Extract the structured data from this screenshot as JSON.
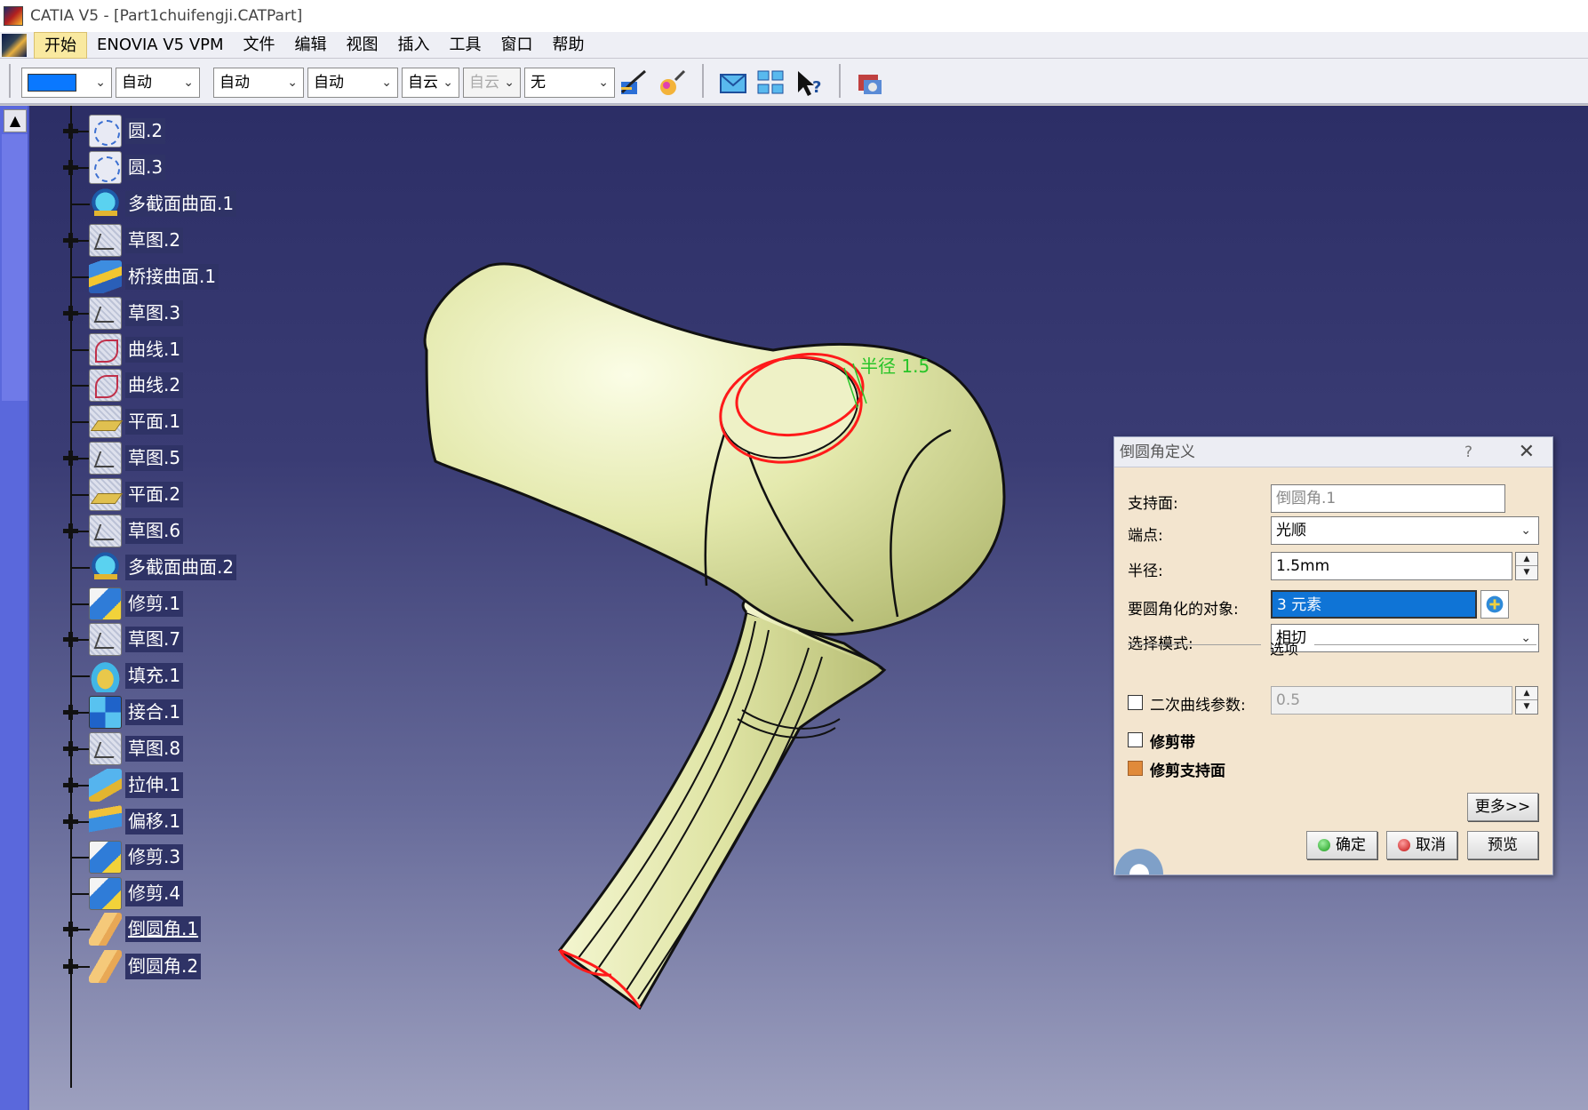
{
  "window": {
    "title": "CATIA V5 - [Part1chuifengji.CATPart]"
  },
  "menu": {
    "items": [
      "开始",
      "ENOVIA V5 VPM",
      "文件",
      "编辑",
      "视图",
      "插入",
      "工具",
      "窗口",
      "帮助"
    ]
  },
  "toolbar": {
    "color_swatch": "#0a78ff",
    "selects": [
      "自动",
      "自动",
      "自动",
      "自动",
      "无"
    ],
    "select_truncated": [
      "自云",
      "自云"
    ],
    "icons": [
      "paintbrush-icon",
      "magic-wand-icon",
      "envelope-icon",
      "grid-selection-icon",
      "whats-this-icon",
      "render-icon"
    ]
  },
  "tree": {
    "items": [
      {
        "label": "圆.2",
        "icon": "circle-icon",
        "expandable": true
      },
      {
        "label": "圆.3",
        "icon": "circle-icon",
        "expandable": true
      },
      {
        "label": "多截面曲面.1",
        "icon": "multi-section-surface-icon",
        "expandable": false
      },
      {
        "label": "草图.2",
        "icon": "sketch-icon",
        "expandable": true
      },
      {
        "label": "桥接曲面.1",
        "icon": "blend-surface-icon",
        "expandable": false
      },
      {
        "label": "草图.3",
        "icon": "sketch-icon",
        "expandable": true
      },
      {
        "label": "曲线.1",
        "icon": "curve-icon",
        "expandable": false
      },
      {
        "label": "曲线.2",
        "icon": "curve-icon",
        "expandable": false
      },
      {
        "label": "平面.1",
        "icon": "plane-icon",
        "expandable": false
      },
      {
        "label": "草图.5",
        "icon": "sketch-icon",
        "expandable": true
      },
      {
        "label": "平面.2",
        "icon": "plane-icon",
        "expandable": false
      },
      {
        "label": "草图.6",
        "icon": "sketch-icon",
        "expandable": true
      },
      {
        "label": "多截面曲面.2",
        "icon": "multi-section-surface-icon",
        "expandable": false
      },
      {
        "label": "修剪.1",
        "icon": "trim-icon",
        "expandable": false
      },
      {
        "label": "草图.7",
        "icon": "sketch-icon",
        "expandable": true
      },
      {
        "label": "填充.1",
        "icon": "fill-icon",
        "expandable": false
      },
      {
        "label": "接合.1",
        "icon": "join-icon",
        "expandable": true
      },
      {
        "label": "草图.8",
        "icon": "sketch-icon",
        "expandable": true
      },
      {
        "label": "拉伸.1",
        "icon": "extrude-icon",
        "expandable": true
      },
      {
        "label": "偏移.1",
        "icon": "offset-icon",
        "expandable": true
      },
      {
        "label": "修剪.3",
        "icon": "trim-icon",
        "expandable": false
      },
      {
        "label": "修剪.4",
        "icon": "trim-icon",
        "expandable": false
      },
      {
        "label": "倒圆角.1",
        "icon": "fillet-icon",
        "expandable": true,
        "selected": true
      },
      {
        "label": "倒圆角.2",
        "icon": "fillet-icon",
        "expandable": true
      }
    ]
  },
  "viewport": {
    "annotation": "半径 1.5",
    "model_color": "#e6ebb0",
    "highlight_color": "#ff1a1a"
  },
  "dialog": {
    "title": "倒圆角定义",
    "help": "?",
    "close": "✕",
    "support_label": "支持面:",
    "support_value": "倒圆角.1",
    "ends_label": "端点:",
    "ends_value": "光顺",
    "radius_label": "半径:",
    "radius_value": "1.5mm",
    "objects_label": "要圆角化的对象:",
    "objects_value": "3 元素",
    "mode_label": "选择模式:",
    "mode_value": "相切",
    "options_label": "选项",
    "conic_label": "二次曲线参数:",
    "conic_value": "0.5",
    "trim_ribbon_label": "修剪带",
    "trim_support_label": "修剪支持面",
    "more_button": "更多>>",
    "ok_button": "确定",
    "cancel_button": "取消",
    "preview_button": "预览"
  }
}
